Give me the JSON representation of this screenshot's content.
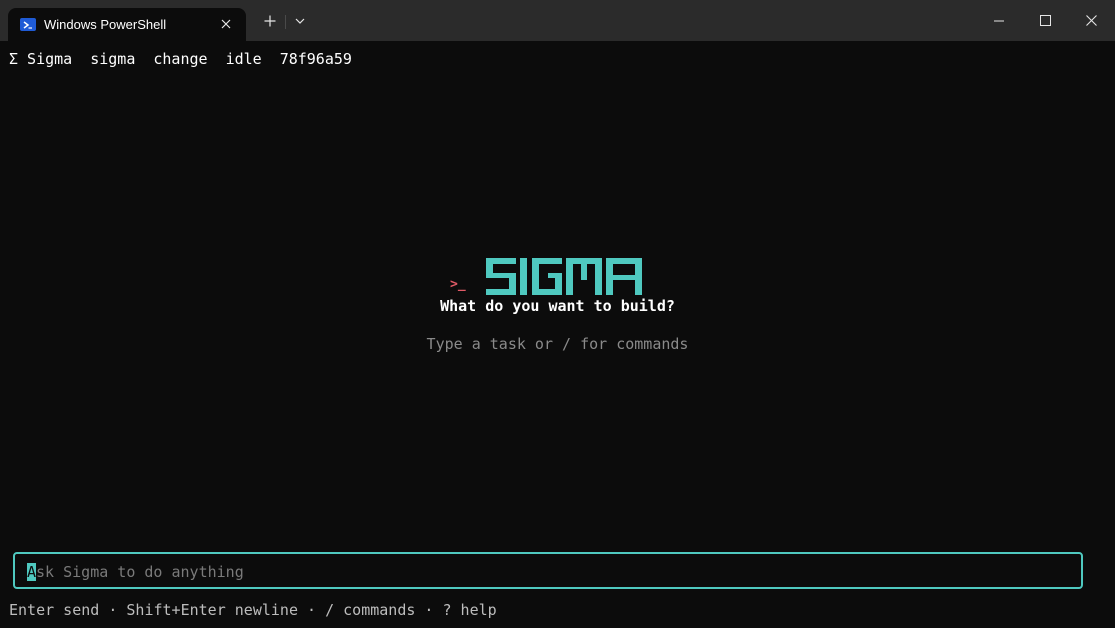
{
  "window": {
    "tab_title": "Windows PowerShell",
    "icons": {
      "tab": "powershell-icon",
      "close_tab": "close-icon",
      "new_tab": "plus-icon",
      "dropdown": "chevron-down-icon",
      "minimize": "minimize-icon",
      "maximize": "maximize-icon",
      "close_window": "close-icon"
    }
  },
  "status": {
    "brand": "Σ Sigma",
    "workspace": "sigma",
    "mode": "change",
    "state": "idle",
    "commit": "78f96a59"
  },
  "splash": {
    "prompt_glyph": ">_",
    "logo_text": "SIGMA",
    "heading": "What do you want to build?",
    "hint": "Type a task or / for commands"
  },
  "input": {
    "placeholder_first": "A",
    "placeholder_rest": "sk Sigma to do anything"
  },
  "footer": {
    "help": "Enter send · Shift+Enter newline · / commands · ? help"
  },
  "colors": {
    "accent": "#4fc9c0",
    "prompt": "#e05a66",
    "background": "#0c0c0c",
    "titlebar": "#2b2b2b"
  }
}
